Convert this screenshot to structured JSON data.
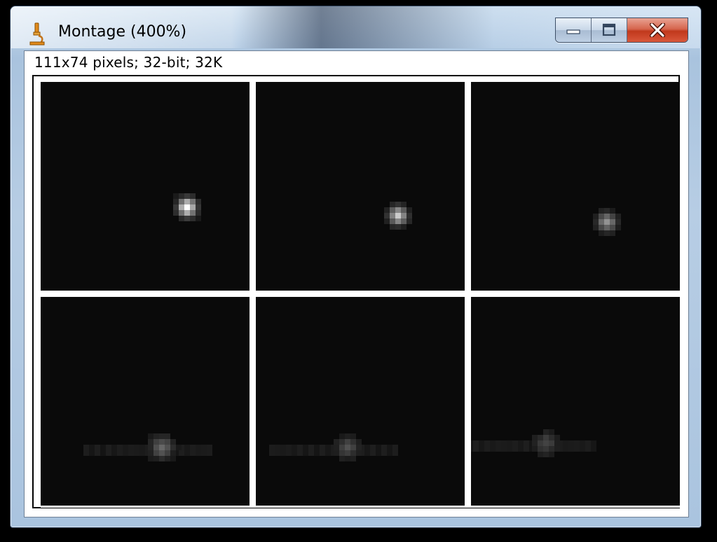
{
  "window": {
    "title": "Montage (400%)",
    "app_icon": "microscope-icon",
    "buttons": {
      "minimize_icon": "minimize-icon",
      "maximize_icon": "maximize-icon",
      "close_icon": "close-icon"
    }
  },
  "image_info": "111x74 pixels; 32-bit; 32K",
  "montage": {
    "rows": 2,
    "columns": 3,
    "tiles": [
      {
        "intensity": 1.0
      },
      {
        "intensity": 0.75
      },
      {
        "intensity": 0.55
      },
      {
        "intensity": 0.35
      },
      {
        "intensity": 0.25
      },
      {
        "intensity": 0.22
      }
    ]
  },
  "colors": {
    "background": "#000000",
    "tile_background": "#0a0a0a",
    "grid_lines": "#ffffff",
    "close_button": "#c94a2e"
  }
}
